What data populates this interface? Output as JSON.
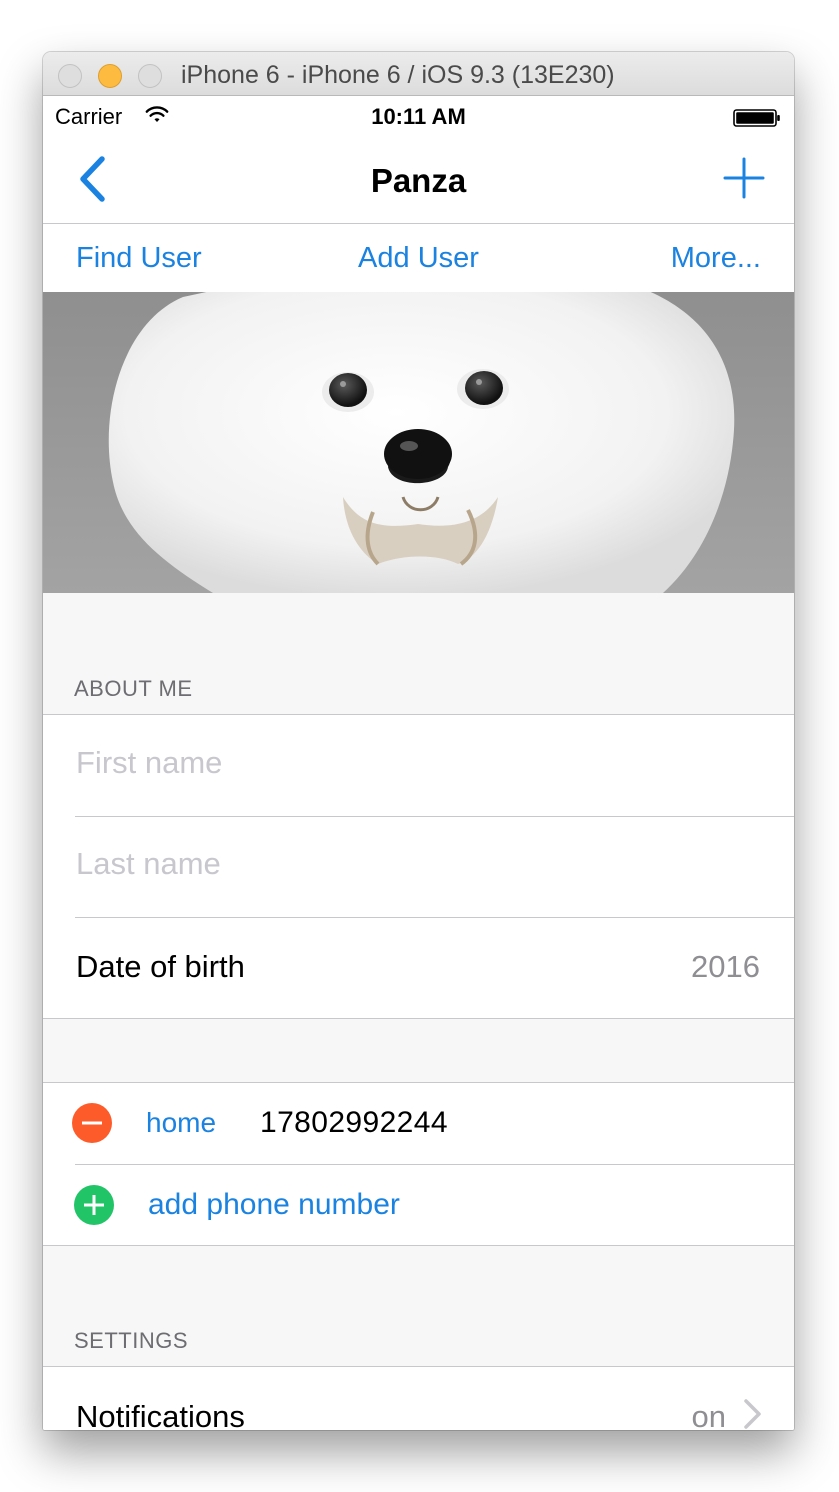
{
  "window": {
    "title": "iPhone 6 - iPhone 6 / iOS 9.3 (13E230)"
  },
  "status_bar": {
    "carrier": "Carrier",
    "time": "10:11 AM"
  },
  "nav": {
    "title": "Panza",
    "back_icon": "chevron-left-icon",
    "add_icon": "plus-icon"
  },
  "toolbar": {
    "find_user": "Find User",
    "add_user": "Add User",
    "more": "More..."
  },
  "photo": {
    "subject": "dog-photo"
  },
  "about": {
    "header": "ABOUT ME",
    "first_name_placeholder": "First name",
    "last_name_placeholder": "Last name",
    "dob_label": "Date of birth",
    "dob_value": "2016"
  },
  "phones": {
    "items": [
      {
        "type": "home",
        "number": "17802992244"
      }
    ],
    "add_label": "add phone number"
  },
  "settings": {
    "header": "SETTINGS",
    "notifications_label": "Notifications",
    "notifications_value": "on"
  },
  "colors": {
    "tint": "#1a82e0",
    "delete": "#fd5b2a",
    "insert": "#21c466",
    "separator": "#c8c7cc",
    "group_bg": "#f7f7f7"
  }
}
